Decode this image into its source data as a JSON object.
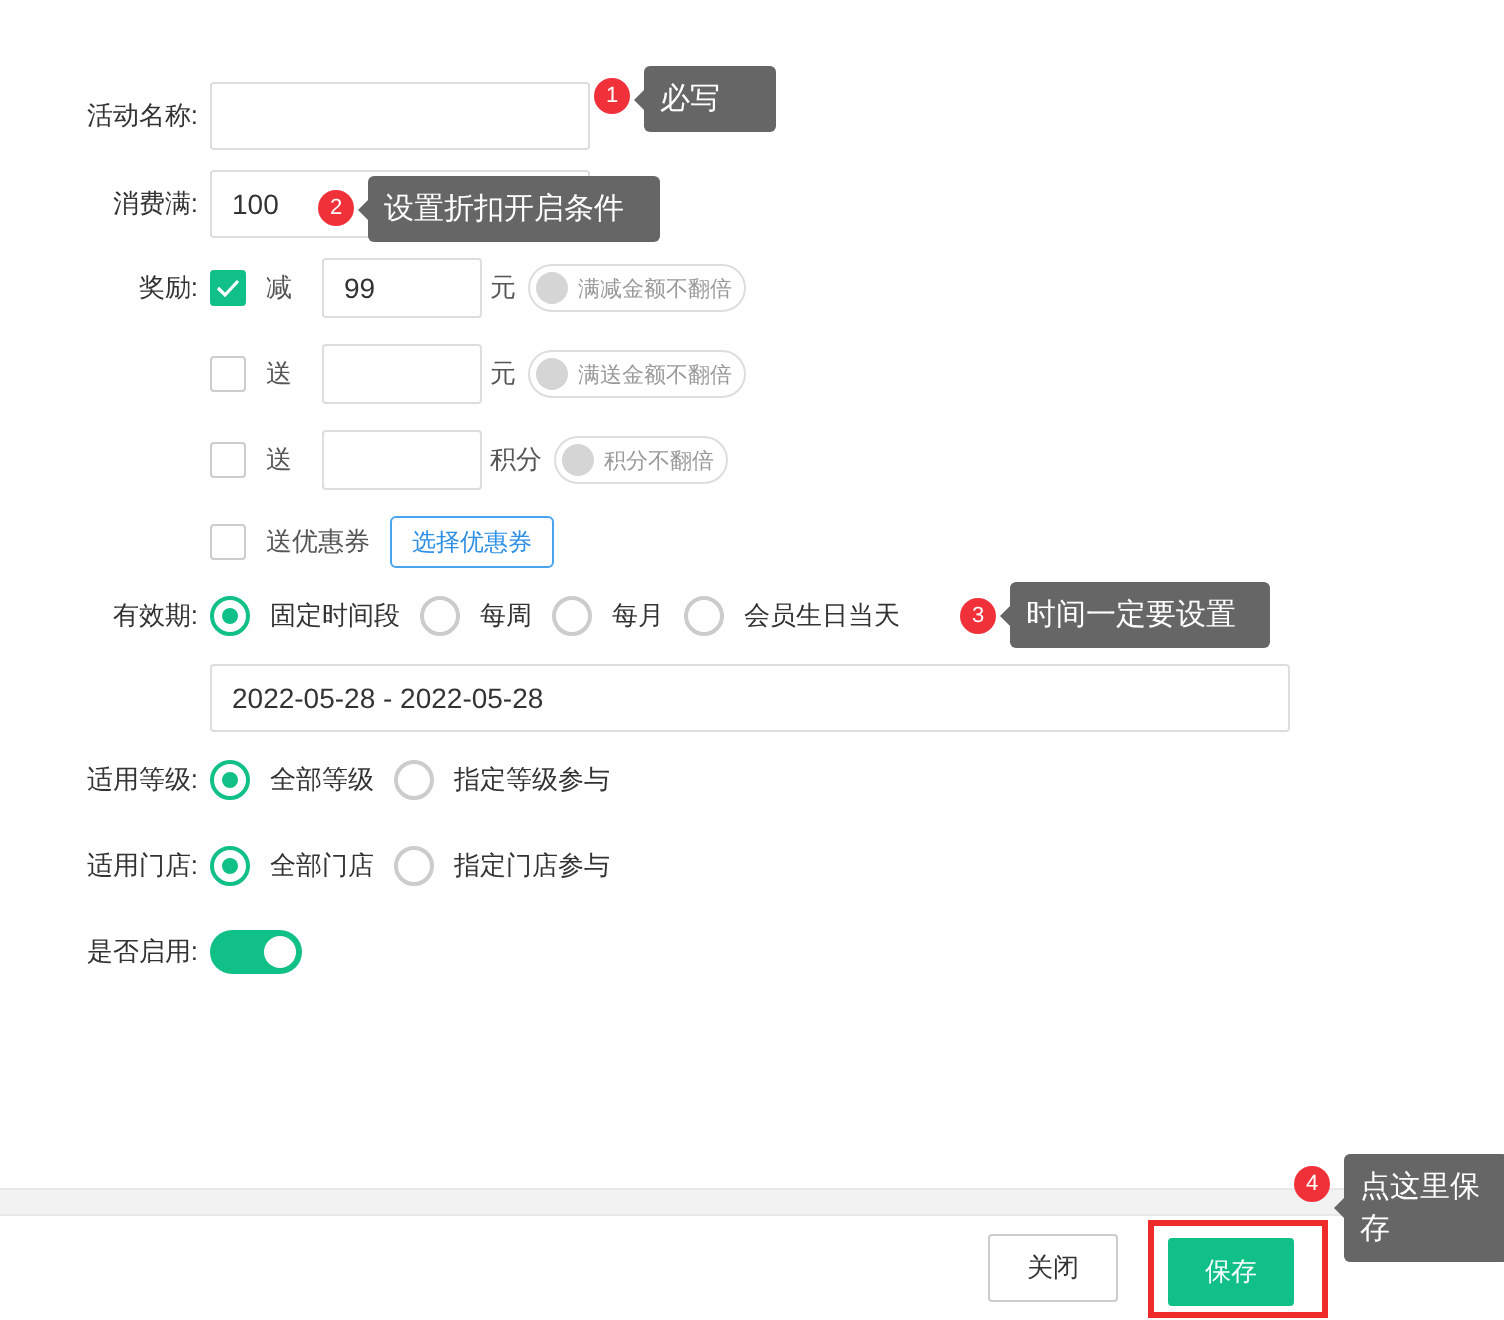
{
  "name_field": {
    "label": "活动名称:"
  },
  "threshold_field": {
    "label": "消费满:",
    "value": "100"
  },
  "rewards": {
    "label": "奖励:",
    "rows": [
      {
        "kind": "amount",
        "checked": true,
        "action": "减",
        "value": "99",
        "unit": "元",
        "toggle": {
          "label": "满减金额不翻倍",
          "on": false
        }
      },
      {
        "kind": "amount",
        "checked": false,
        "action": "送",
        "value": "",
        "unit": "元",
        "toggle": {
          "label": "满送金额不翻倍",
          "on": false
        }
      },
      {
        "kind": "amount",
        "checked": false,
        "action": "送",
        "value": "",
        "unit": "积分",
        "toggle": {
          "label": "积分不翻倍",
          "on": false
        }
      },
      {
        "kind": "coupon",
        "checked": false,
        "action": "送优惠券",
        "button": "选择优惠券"
      }
    ]
  },
  "validity": {
    "label": "有效期:",
    "options": [
      {
        "label": "固定时间段",
        "selected": true
      },
      {
        "label": "每周",
        "selected": false
      },
      {
        "label": "每月",
        "selected": false
      },
      {
        "label": "会员生日当天",
        "selected": false
      }
    ],
    "date_range": "2022-05-28 - 2022-05-28"
  },
  "member_level": {
    "label": "适用等级:",
    "options": [
      {
        "label": "全部等级",
        "selected": true
      },
      {
        "label": "指定等级参与",
        "selected": false
      }
    ]
  },
  "store": {
    "label": "适用门店:",
    "options": [
      {
        "label": "全部门店",
        "selected": true
      },
      {
        "label": "指定门店参与",
        "selected": false
      }
    ]
  },
  "enabled": {
    "label": "是否启用:",
    "on": true
  },
  "footer": {
    "buttons": [
      {
        "label": "关闭",
        "kind": "secondary",
        "highlighted": false
      },
      {
        "label": "保存",
        "kind": "primary",
        "highlighted": true
      }
    ]
  },
  "annotations": [
    {
      "number": "1",
      "text": "必写"
    },
    {
      "number": "2",
      "text": "设置折扣开启条件"
    },
    {
      "number": "3",
      "text": "时间一定要设置"
    },
    {
      "number": "4",
      "text": "点这里保存"
    }
  ]
}
